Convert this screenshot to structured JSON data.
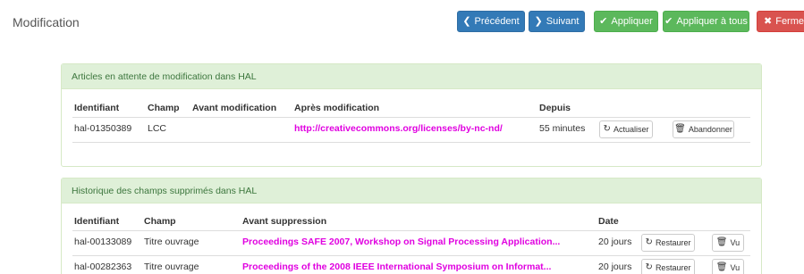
{
  "page": {
    "title": "Modification"
  },
  "toolbar": {
    "previous": "Précédent",
    "next": "Suivant",
    "apply": "Appliquer",
    "apply_all": "Appliquer à tous",
    "close": "Fermer"
  },
  "pending": {
    "heading": "Articles en attente de modification dans HAL",
    "columns": {
      "id": "Identifiant",
      "field": "Champ",
      "before": "Avant modification",
      "after": "Après modification",
      "since": "Depuis"
    },
    "rows": [
      {
        "id": "hal-01350389",
        "field": "LCC",
        "before": "",
        "after": "http://creativecommons.org/licenses/by-nc-nd/",
        "since": "55 minutes",
        "refresh_label": "Actualiser",
        "abandon_label": "Abandonner"
      }
    ]
  },
  "history": {
    "heading": "Historique des champs supprimés dans HAL",
    "columns": {
      "id": "Identifiant",
      "field": "Champ",
      "before": "Avant suppression",
      "date": "Date"
    },
    "rows": [
      {
        "id": "hal-00133089",
        "field": "Titre ouvrage",
        "before": "Proceedings SAFE 2007, Workshop on Signal Processing Application...",
        "date": "20 jours",
        "restore_label": "Restaurer",
        "seen_label": "Vu"
      },
      {
        "id": "hal-00282363",
        "field": "Titre ouvrage",
        "before": "Proceedings of the 2008 IEEE International Symposium on Informat...",
        "date": "20 jours",
        "restore_label": "Restaurer",
        "seen_label": "Vu"
      }
    ]
  },
  "icons": {
    "previous": "chevron-left-icon",
    "next": "chevron-right-icon",
    "apply": "check-icon",
    "close": "times-icon",
    "refresh": "refresh-icon",
    "abandon": "trash-icon",
    "restore": "refresh-icon",
    "seen": "trash-icon"
  },
  "colors": {
    "primary": "#337ab7",
    "success": "#5cb85c",
    "danger": "#d9534f",
    "panel_heading_bg": "#dff0d8",
    "panel_heading_text": "#3c763d",
    "link": "#e000e0"
  }
}
